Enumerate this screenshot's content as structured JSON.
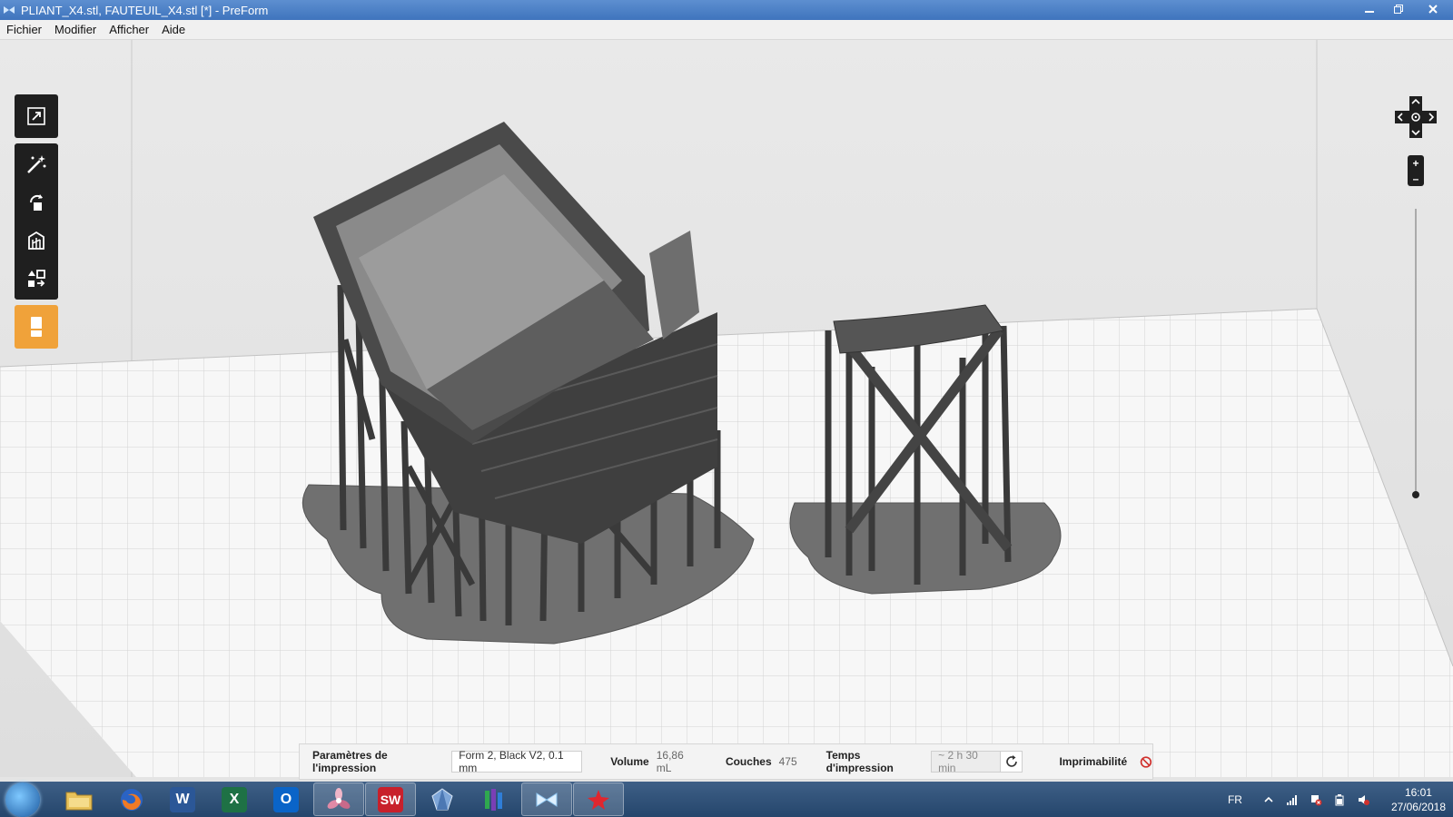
{
  "window": {
    "title": "PLIANT_X4.stl, FAUTEUIL_X4.stl [*] - PreForm",
    "app_icon": "preform-icon",
    "controls": [
      "minimize-icon",
      "restore-icon",
      "close-icon"
    ]
  },
  "menu": {
    "items": [
      "Fichier",
      "Modifier",
      "Afficher",
      "Aide"
    ]
  },
  "toolbar": {
    "tools": [
      "fit-view-icon",
      "magic-wand-icon",
      "rotate-icon",
      "supports-icon",
      "layout-icon"
    ],
    "print_tool": "printer-icon",
    "accent_color": "#f0a23a"
  },
  "navigation": {
    "pad": "navigation-pad-icon",
    "zoom_in": "+",
    "zoom_out": "–"
  },
  "infobar": {
    "settings_label": "Paramètres de l'impression",
    "settings_value": "Form 2, Black V2, 0.1 mm",
    "volume_label": "Volume",
    "volume_value": "16,86 mL",
    "layers_label": "Couches",
    "layers_value": "475",
    "time_label": "Temps d'impression",
    "time_value": "~ 2 h 30 min",
    "printability_label": "Imprimabilité",
    "printability_icon": "prohibited-icon",
    "printability_color": "#d0312d"
  },
  "taskbar": {
    "apps": [
      {
        "name": "file-explorer",
        "glyph": ""
      },
      {
        "name": "firefox",
        "glyph": ""
      },
      {
        "name": "word",
        "glyph": "W"
      },
      {
        "name": "excel",
        "glyph": "X"
      },
      {
        "name": "outlook",
        "glyph": "O"
      },
      {
        "name": "app-propeller",
        "glyph": ""
      },
      {
        "name": "solidworks-2016",
        "glyph": "SW"
      },
      {
        "name": "app-gem",
        "glyph": ""
      },
      {
        "name": "app-bars",
        "glyph": ""
      },
      {
        "name": "preform",
        "glyph": ""
      },
      {
        "name": "app-red",
        "glyph": ""
      }
    ],
    "language": "FR",
    "time": "16:01",
    "date": "27/06/2018"
  }
}
